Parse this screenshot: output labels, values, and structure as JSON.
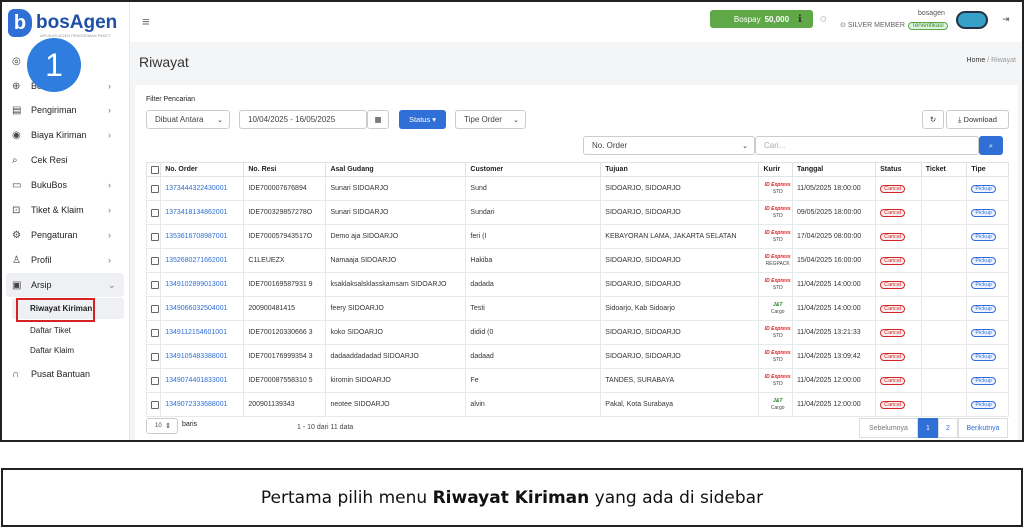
{
  "app": {
    "brand": "bosAgen",
    "tagline": "APLIKASI AGEN PENGIRIMAN PAKET"
  },
  "step_badge": "1",
  "sidebar": {
    "items": [
      {
        "label": "",
        "icon": "dashboard-icon",
        "chevron": false
      },
      {
        "label": "Booking",
        "icon": "plus-circle-icon",
        "chevron": true
      },
      {
        "label": "Pengiriman",
        "icon": "document-icon",
        "chevron": true
      },
      {
        "label": "Biaya Kiriman",
        "icon": "location-pin-icon",
        "chevron": true
      },
      {
        "label": "Cek Resi",
        "icon": "search-icon",
        "chevron": false
      },
      {
        "label": "BukuBos",
        "icon": "wallet-icon",
        "chevron": true
      },
      {
        "label": "Tiket & Klaim",
        "icon": "ticket-icon",
        "chevron": true
      },
      {
        "label": "Pengaturan",
        "icon": "gear-icon",
        "chevron": true
      },
      {
        "label": "Profil",
        "icon": "user-icon",
        "chevron": true
      },
      {
        "label": "Arsip",
        "icon": "archive-icon",
        "chevron": true
      }
    ],
    "sub_items": [
      "Riwayat Kiriman",
      "Daftar Tiket",
      "Daftar Klaim"
    ],
    "help": "Pusat Bantuan"
  },
  "topbar": {
    "bospay_label": "Bospay",
    "bospay_value": "50,000",
    "member": "SILVER MEMBER",
    "verified": "Terverifikasi",
    "username": "bosagen"
  },
  "page": {
    "title": "Riwayat",
    "crumb_home": "Home",
    "crumb_sep": "/",
    "crumb_current": "Riwayat"
  },
  "filter": {
    "title": "Filter Pencarian",
    "date_type": "Dibuat Antara",
    "date_range": "10/04/2025 - 16/05/2025",
    "status_btn": "Status",
    "tipe_order": "Tipe Order",
    "search_field": "No. Order",
    "search_placeholder": "Cari...",
    "download": "Download"
  },
  "table": {
    "headers": [
      "No. Order",
      "No. Resi",
      "Asal Gudang",
      "Customer",
      "Tujuan",
      "Kurir",
      "Tanggal",
      "Status",
      "Ticket",
      "Tipe"
    ],
    "rows": [
      {
        "order": "1373444322430001",
        "resi": "IDE700007676894",
        "asal": "Sunari SIDOARJO",
        "customer": "Sund",
        "tujuan": "SIDOARJO, SIDOARJO",
        "kurir": "ID Express",
        "svc": "STD",
        "tanggal": "11/05/2025 18:00:00",
        "status": "Cancel",
        "tipe": "Pickup"
      },
      {
        "order": "1373418134862001",
        "resi": "IDE700329857278O",
        "asal": "Sunari SIDOARJO",
        "customer": "Sundari",
        "tujuan": "SIDOARJO, SIDOARJO",
        "kurir": "ID Express",
        "svc": "STD",
        "tanggal": "09/05/2025 18:00:00",
        "status": "Cancel",
        "tipe": "Pickup"
      },
      {
        "order": "1353616708987001",
        "resi": "IDE700057943517O",
        "asal": "Demo aja SIDOARJO",
        "customer": "feri (I",
        "tujuan": "KEBAYORAN LAMA, JAKARTA SELATAN",
        "kurir": "ID Express",
        "svc": "STD",
        "tanggal": "17/04/2025 08:00:00",
        "status": "Cancel",
        "tipe": "Pickup"
      },
      {
        "order": "1352680271662001",
        "resi": "C1LEUEZX",
        "asal": "Namaaja SIDOARJO",
        "customer": "Hakiba",
        "tujuan": "SIDOARJO, SIDOARJO",
        "kurir": "ID Express",
        "svc": "REGPACK",
        "tanggal": "15/04/2025 16:00:00",
        "status": "Cancel",
        "tipe": "Pickup"
      },
      {
        "order": "1349102899013001",
        "resi": "IDE700169587931 9",
        "asal": "ksaklaksalsklasskamsam SIDOARJO",
        "customer": "dadada",
        "tujuan": "SIDOARJO, SIDOARJO",
        "kurir": "ID Express",
        "svc": "STD",
        "tanggal": "11/04/2025 14:00:00",
        "status": "Cancel",
        "tipe": "Pickup"
      },
      {
        "order": "1349066032504001",
        "resi": "200900481415",
        "asal": "feery SIDOARJO",
        "customer": "Testi",
        "tujuan": "Sidoarjo, Kab Sidoarjo",
        "kurir": "J&T",
        "svc": "Cargo",
        "tanggal": "11/04/2025 14:00:00",
        "status": "Cancel",
        "tipe": "Pickup"
      },
      {
        "order": "1349112154601001",
        "resi": "IDE700120330666 3",
        "asal": "koko SIDOARJO",
        "customer": "didid (0",
        "tujuan": "SIDOARJO, SIDOARJO",
        "kurir": "ID Express",
        "svc": "STD",
        "tanggal": "11/04/2025 13:21:33",
        "status": "Cancel",
        "tipe": "Pickup"
      },
      {
        "order": "1349105483388001",
        "resi": "IDE700176999354 3",
        "asal": "dadaaddadadad SIDOARJO",
        "customer": "dadaad",
        "tujuan": "SIDOARJO, SIDOARJO",
        "kurir": "ID Express",
        "svc": "STD",
        "tanggal": "11/04/2025 13:09:42",
        "status": "Cancel",
        "tipe": "Pickup"
      },
      {
        "order": "1349074401833001",
        "resi": "IDE700087558310 5",
        "asal": "kiromin SIDOARJO",
        "customer": "Fe",
        "tujuan": "TANDES, SURABAYA",
        "kurir": "ID Express",
        "svc": "STD",
        "tanggal": "11/04/2025 12:00:00",
        "status": "Cancel",
        "tipe": "Pickup"
      },
      {
        "order": "1349072333688001",
        "resi": "200901139343",
        "asal": "neotee SIDOARJO",
        "customer": "alvin",
        "tujuan": "Pakal, Kota Surabaya",
        "kurir": "J&T",
        "svc": "Cargo",
        "tanggal": "11/04/2025 12:00:00",
        "status": "Cancel",
        "tipe": "Pickup"
      }
    ]
  },
  "footer": {
    "page_size": "10",
    "baris": "baris",
    "info": "1 - 10 dari 11 data",
    "prev": "Sebelumnya",
    "p1": "1",
    "p2": "2",
    "next": "Berikutnya"
  },
  "caption": {
    "pre": "Pertama pilih menu ",
    "bold": "Riwayat Kiriman",
    "post": " yang ada di sidebar"
  },
  "colors": {
    "accent": "#2f6fd6",
    "bospay": "#5fa848",
    "cancel": "#d62222",
    "highlight": "#d62222"
  }
}
